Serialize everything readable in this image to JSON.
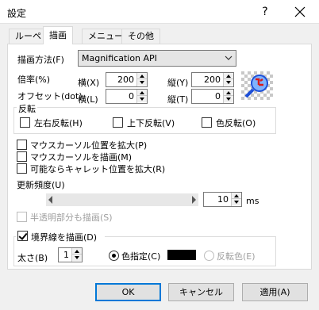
{
  "window": {
    "title": "設定",
    "help_label": "?",
    "close_icon": "close-icon"
  },
  "tabs": [
    {
      "label": "ルーペ",
      "active": false
    },
    {
      "label": "描画",
      "active": true
    },
    {
      "label": "メニュー",
      "active": false
    },
    {
      "label": "その他",
      "active": false
    }
  ],
  "drawing": {
    "method_label": "描画方法(F)",
    "method_value": "Magnification API",
    "magnification_label": "倍率(%)",
    "mag_width_label": "横(X)",
    "mag_width_value": "200",
    "mag_height_label": "縦(Y)",
    "mag_height_value": "200",
    "offset_label": "オフセット(dot)",
    "offset_x_label": "横(L)",
    "offset_x_value": "0",
    "offset_y_label": "縦(T)",
    "offset_y_value": "0",
    "preview_icon": "magnifier-icon"
  },
  "invert": {
    "group_label": "反転",
    "horizontal_label": "左右反転(H)",
    "horizontal_checked": false,
    "vertical_label": "上下反転(V)",
    "vertical_checked": false,
    "color_label": "色反転(O)",
    "color_checked": false
  },
  "options": {
    "zoom_mouse_label": "マウスカーソル位置を拡大(P)",
    "zoom_mouse_checked": false,
    "draw_mouse_label": "マウスカーソルを描画(M)",
    "draw_mouse_checked": false,
    "zoom_caret_label": "可能ならキャレット位置を拡大(R)",
    "zoom_caret_checked": false
  },
  "refresh": {
    "label": "更新頻度(U)",
    "value": "10",
    "unit": "ms"
  },
  "translucent": {
    "label": "半透明部分も描画(S)",
    "checked": false,
    "enabled": false
  },
  "border": {
    "label": "境界線を描画(D)",
    "checked": true,
    "thickness_label": "太さ(B)",
    "thickness_value": "1",
    "color_specified_label": "色指定(C)",
    "color_specified_selected": true,
    "color_value": "#000000",
    "inverted_color_label": "反転色(E)",
    "inverted_color_selected": false
  },
  "buttons": {
    "ok": "OK",
    "cancel": "キャンセル",
    "apply": "適用(A)"
  },
  "colors": {
    "accent": "#0078d7",
    "window_bg": "#f0f0f0",
    "panel_bg": "#ffffff"
  }
}
